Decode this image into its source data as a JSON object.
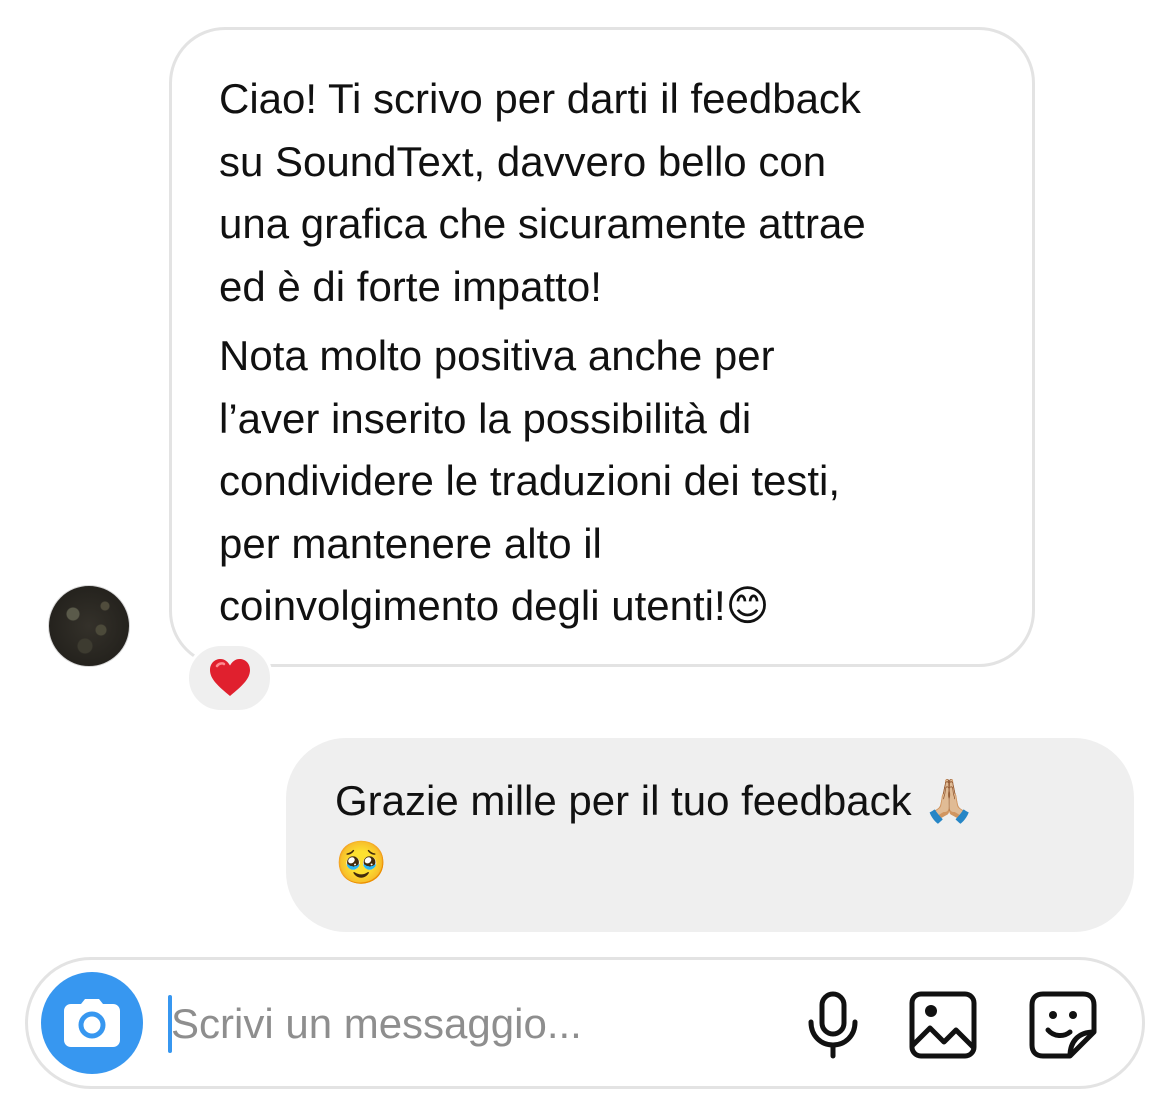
{
  "conversation": {
    "incoming": {
      "paragraphs": [
        "Ciao! Ti scrivo per darti il feedback\nsu SoundText, davvero bello con\nuna grafica che sicuramente attrae\ned è di forte impatto!",
        "Nota molto positiva anche per\nl’aver inserito la possibilità di\ncondividere le traduzioni dei testi,\nper mantenere alto il\ncoinvolgimento degli utenti!😊"
      ],
      "reaction": "heart-icon"
    },
    "outgoing": {
      "text": "Grazie mille per il tuo feedback 🙏🏼\n🥹"
    }
  },
  "composer": {
    "placeholder": "Scrivi un messaggio...",
    "icons": [
      "camera-icon",
      "microphone-icon",
      "image-icon",
      "sticker-icon"
    ],
    "accent_color": "#3797f0"
  }
}
